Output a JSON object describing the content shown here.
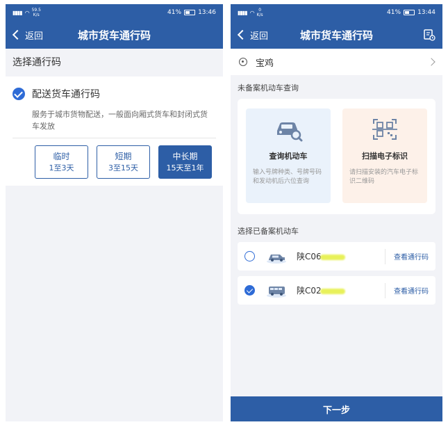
{
  "screen1": {
    "status": {
      "speed": "59.5",
      "speed_unit": "K/s",
      "battery": "41%",
      "time": "13:46"
    },
    "nav": {
      "back_label": "返回",
      "title": "城市货车通行码"
    },
    "section_title": "选择通行码",
    "option": {
      "label": "配送货车通行码",
      "description": "服务于城市货物配送，一般面向厢式货车和封闭式货车发放"
    },
    "periods": [
      {
        "name": "临时",
        "range": "1至3天",
        "active": false
      },
      {
        "name": "短期",
        "range": "3至15天",
        "active": false
      },
      {
        "name": "中长期",
        "range": "15天至1年",
        "active": true
      }
    ]
  },
  "screen2": {
    "status": {
      "speed": "0",
      "speed_unit": "K/s",
      "battery": "41%",
      "time": "13:44"
    },
    "nav": {
      "back_label": "返回",
      "title": "城市货车通行码"
    },
    "location": "宝鸡",
    "unregistered_title": "未备案机动车查询",
    "query": {
      "title": "查询机动车",
      "desc": "输入号牌种类、号牌号码和发动机后六位查询"
    },
    "scan": {
      "title": "扫描电子标识",
      "desc": "请扫描安装的汽车电子标识二维码"
    },
    "registered_title": "选择已备案机动车",
    "vehicles": [
      {
        "plate": "陕C06",
        "link": "查看通行码",
        "selected": false
      },
      {
        "plate": "陕C02",
        "link": "查看通行码",
        "selected": true
      }
    ],
    "next_label": "下一步"
  },
  "colors": {
    "primary": "#2d5ea6",
    "check": "#2e6bd6"
  }
}
